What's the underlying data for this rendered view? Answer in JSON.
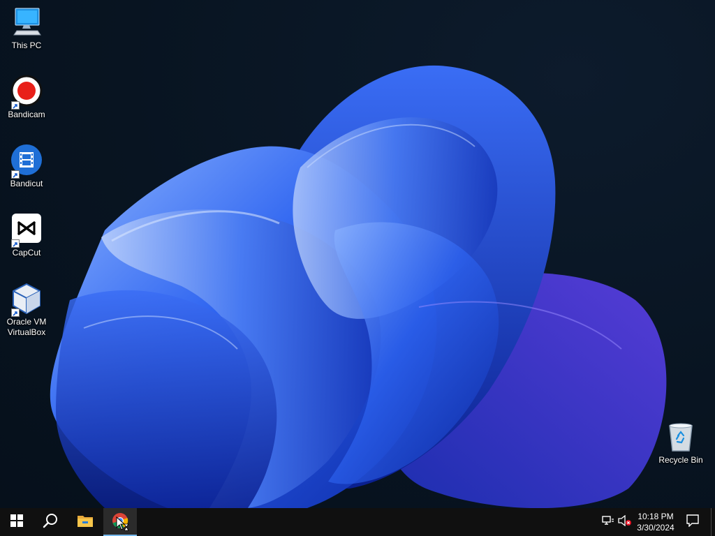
{
  "desktop": {
    "icons": [
      {
        "label": "This PC",
        "icon": "computer-icon",
        "shortcut": false
      },
      {
        "label": "Bandicam",
        "icon": "bandicam-record-icon",
        "shortcut": true
      },
      {
        "label": "Bandicut",
        "icon": "bandicut-film-icon",
        "shortcut": true
      },
      {
        "label": "CapCut",
        "icon": "capcut-icon",
        "shortcut": true
      },
      {
        "label": "Oracle VM VirtualBox",
        "icon": "virtualbox-cube-icon",
        "shortcut": true
      },
      {
        "label": "Recycle Bin",
        "icon": "recycle-bin-icon",
        "shortcut": false
      }
    ]
  },
  "taskbar": {
    "start_icon": "windows-start-icon",
    "search_icon": "search-icon",
    "pinned": [
      {
        "name": "File Explorer",
        "icon": "folder-icon"
      },
      {
        "name": "Google Chrome",
        "icon": "chrome-icon",
        "active": true
      }
    ],
    "tray": {
      "network_icon": "network-disconnected-icon",
      "volume_icon": "volume-muted-icon",
      "time": "10:18 PM",
      "date": "3/30/2024",
      "notification_icon": "action-center-icon"
    }
  },
  "colors": {
    "wallpaper_bg": "#07121f",
    "bloom_blue": "#1f4fd8",
    "taskbar": "#101010",
    "accent": "#76b9ed"
  }
}
